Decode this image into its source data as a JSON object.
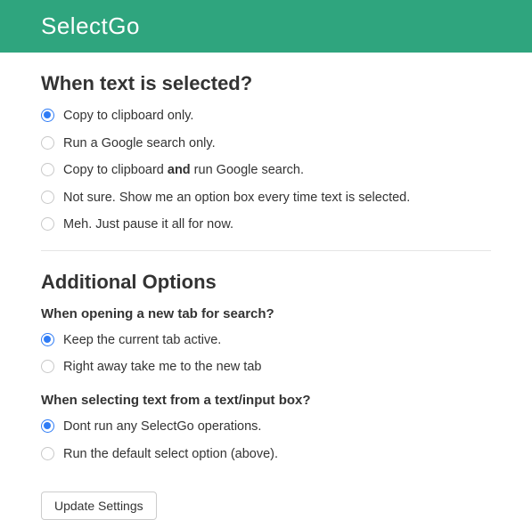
{
  "header": {
    "title": "SelectGo"
  },
  "section1": {
    "heading": "When text is selected?",
    "options": [
      {
        "label": "Copy to clipboard only.",
        "checked": true
      },
      {
        "label": "Run a Google search only.",
        "checked": false
      },
      {
        "label_html": "Copy to clipboard <b>and</b> run Google search.",
        "checked": false,
        "wrap": true
      },
      {
        "label": "Not sure. Show me an option box every time text is selected.",
        "checked": false
      },
      {
        "label": "Meh. Just pause it all for now.",
        "checked": false
      }
    ]
  },
  "section2": {
    "heading": "Additional Options",
    "sub1": {
      "heading": "When opening a new tab for search?",
      "options": [
        {
          "label": "Keep the current tab active.",
          "checked": true
        },
        {
          "label": "Right away take me to the new tab",
          "checked": false
        }
      ]
    },
    "sub2": {
      "heading": "When selecting text from a text/input box?",
      "options": [
        {
          "label": "Dont run any SelectGo operations.",
          "checked": true
        },
        {
          "label": "Run the default select option (above).",
          "checked": false
        }
      ]
    }
  },
  "button": {
    "label": "Update Settings"
  }
}
